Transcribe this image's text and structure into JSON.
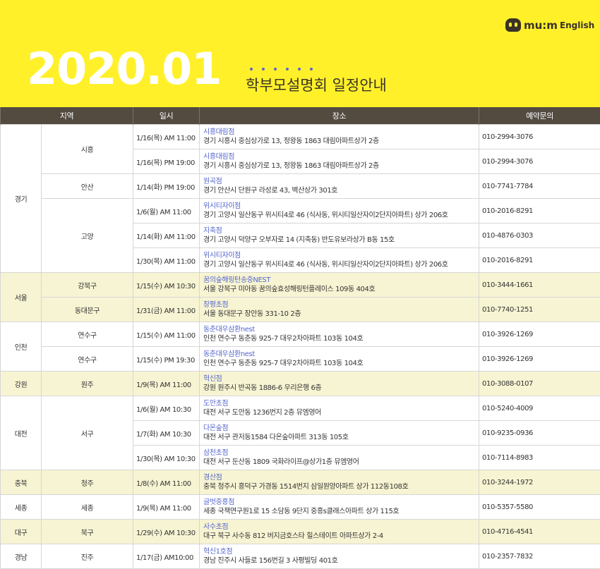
{
  "logo": {
    "brand": "mu:m",
    "suffix": "English"
  },
  "title": {
    "year": "2020.01",
    "subtitle": "학부모설명회 일정안내"
  },
  "colors": {
    "header_bg": "#fff02a",
    "table_header": "#534a40",
    "place_name": "#5566cc",
    "shade": "#f7f4d3"
  },
  "table": {
    "headers": [
      "지역",
      "일시",
      "장소",
      "예약문의"
    ],
    "groups": [
      {
        "region": "경기",
        "shade": false,
        "cities": [
          {
            "name": "시흥",
            "rows": [
              {
                "date": "1/16(목) AM 11:00",
                "place": "시흥대림점",
                "address": "경기 시흥시 중심상가로 13, 정왕동 1863 대림아파트상가 2층",
                "phone": "010-2994-3076"
              },
              {
                "date": "1/16(목) PM 19:00",
                "place": "시흥대림점",
                "address": "경기 시흥시 중심상가로 13, 정왕동 1863 대림아파트상가 2층",
                "phone": "010-2994-3076"
              }
            ]
          },
          {
            "name": "안산",
            "rows": [
              {
                "date": "1/14(화) PM 19:00",
                "place": "원곡점",
                "address": "경기 안산시 단원구 라성로 43, 벽산상가 301호",
                "phone": "010-7741-7784"
              }
            ]
          },
          {
            "name": "고양",
            "rows": [
              {
                "date": "1/6(월) AM 11:00",
                "place": "위시티자이점",
                "address": "경기 고양시 일산동구 위시티4로 46 (식사동, 위시티일산자이2단지아파트) 상가 206호",
                "phone": "010-2016-8291"
              },
              {
                "date": "1/14(화) AM 11:00",
                "place": "지축점",
                "address": "경기 고양시 덕양구 오부자로 14 (지축동) 반도유보라상가 B동 15호",
                "phone": "010-4876-0303"
              },
              {
                "date": "1/30(목) AM 11:00",
                "place": "위시티자이점",
                "address": "경기 고양시 일산동구 위시티4로 46 (식사동, 위시티일산자이2단지아파트) 상가 206호",
                "phone": "010-2016-8291"
              }
            ]
          }
        ]
      },
      {
        "region": "서울",
        "shade": true,
        "cities": [
          {
            "name": "강북구",
            "rows": [
              {
                "date": "1/15(수) AM 10:30",
                "place": "꿈의숲해링턴송중NEST",
                "address": "서울 강북구 미아동 꿈의숲효성해링턴플레이스 109동 404호",
                "phone": "010-3444-1661"
              }
            ]
          },
          {
            "name": "동대문구",
            "rows": [
              {
                "date": "1/31(금) AM 11:00",
                "place": "장평초점",
                "address": "서울 동대문구 장안동 331-10 2층",
                "phone": "010-7740-1251"
              }
            ]
          }
        ]
      },
      {
        "region": "인천",
        "shade": false,
        "cities": [
          {
            "name": "연수구",
            "rows": [
              {
                "date": "1/15(수) AM 11:00",
                "place": "동춘대우삼환nest",
                "address": "인천 연수구 동춘동 925-7 대우2차아파트 103동 104호",
                "phone": "010-3926-1269"
              }
            ]
          },
          {
            "name": "연수구",
            "rows": [
              {
                "date": "1/15(수) PM 19:30",
                "place": "동춘대우삼환nest",
                "address": "인천 연수구 동춘동 925-7 대우2차아파트 103동 104호",
                "phone": "010-3926-1269"
              }
            ]
          }
        ]
      },
      {
        "region": "강원",
        "shade": true,
        "cities": [
          {
            "name": "원주",
            "rows": [
              {
                "date": "1/9(목) AM 11:00",
                "place": "혁신점",
                "address": "강원 원주시 반곡동 1886-6 우리은행 6층",
                "phone": "010-3088-0107"
              }
            ]
          }
        ]
      },
      {
        "region": "대전",
        "shade": false,
        "cities": [
          {
            "name": "서구",
            "rows": [
              {
                "date": "1/6(월) AM 10:30",
                "place": "도안초점",
                "address": "대전 서구 도안동 1236번지 2층 뮤엠영어",
                "phone": "010-5240-4009"
              },
              {
                "date": "1/7(화) AM 10:30",
                "place": "다온숲점",
                "address": "대전 서구 관저동1584 다온숲아파트 313동 105호",
                "phone": "010-9235-0936"
              },
              {
                "date": "1/30(목) AM 10:30",
                "place": "삼천초점",
                "address": "대전 서구 둔산동 1809 국화라이프@상가1층 뮤엠영어",
                "phone": "010-7114-8983"
              }
            ]
          }
        ]
      },
      {
        "region": "충북",
        "shade": true,
        "cities": [
          {
            "name": "청주",
            "rows": [
              {
                "date": "1/8(수) AM 11:00",
                "place": "경산점",
                "address": "충북 청주시 흥덕구 가경동 1514번지 삼일원양아파트 상가 112동108호",
                "phone": "010-3244-1972"
              }
            ]
          }
        ]
      },
      {
        "region": "세종",
        "shade": false,
        "cities": [
          {
            "name": "세종",
            "rows": [
              {
                "date": "1/9(목) AM 11:00",
                "place": "글벗중흥점",
                "address": "세종 국책연구원1로 15 소담동 9단지 중흥s클래스아파트 상가 115호",
                "phone": "010-5357-5580"
              }
            ]
          }
        ]
      },
      {
        "region": "대구",
        "shade": true,
        "cities": [
          {
            "name": "북구",
            "rows": [
              {
                "date": "1/29(수) AM 10:30",
                "place": "사수초점",
                "address": "대구 북구 사수동 812 버지금호스타 힐스테이트 아파트상가 2-4",
                "phone": "010-4716-4541"
              }
            ]
          }
        ]
      },
      {
        "region": "경남",
        "shade": false,
        "cities": [
          {
            "name": "진주",
            "rows": [
              {
                "date": "1/17(금) AM10:00",
                "place": "혁신1호점",
                "address": "경남 진주시 사들로 156번길 3 사평빌딩 401호",
                "phone": "010-2357-7832"
              }
            ]
          }
        ]
      }
    ]
  }
}
